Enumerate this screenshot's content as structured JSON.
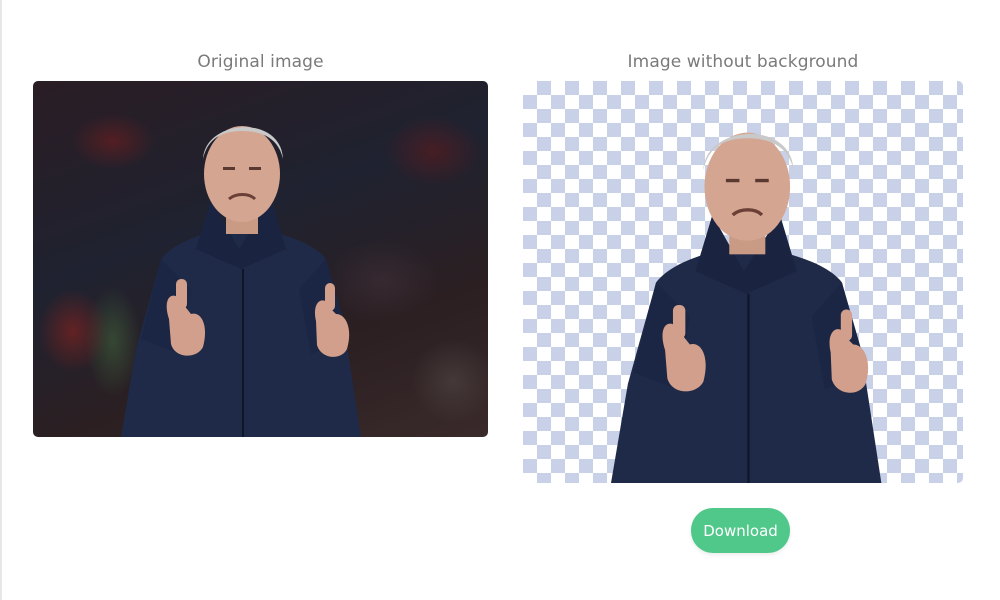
{
  "panels": {
    "original": {
      "title": "Original image"
    },
    "removed": {
      "title": "Image without background"
    }
  },
  "actions": {
    "download_label": "Download"
  },
  "colors": {
    "accent": "#4fc88a",
    "checker": "#c8d1e8",
    "title_text": "#7a7a7a"
  }
}
